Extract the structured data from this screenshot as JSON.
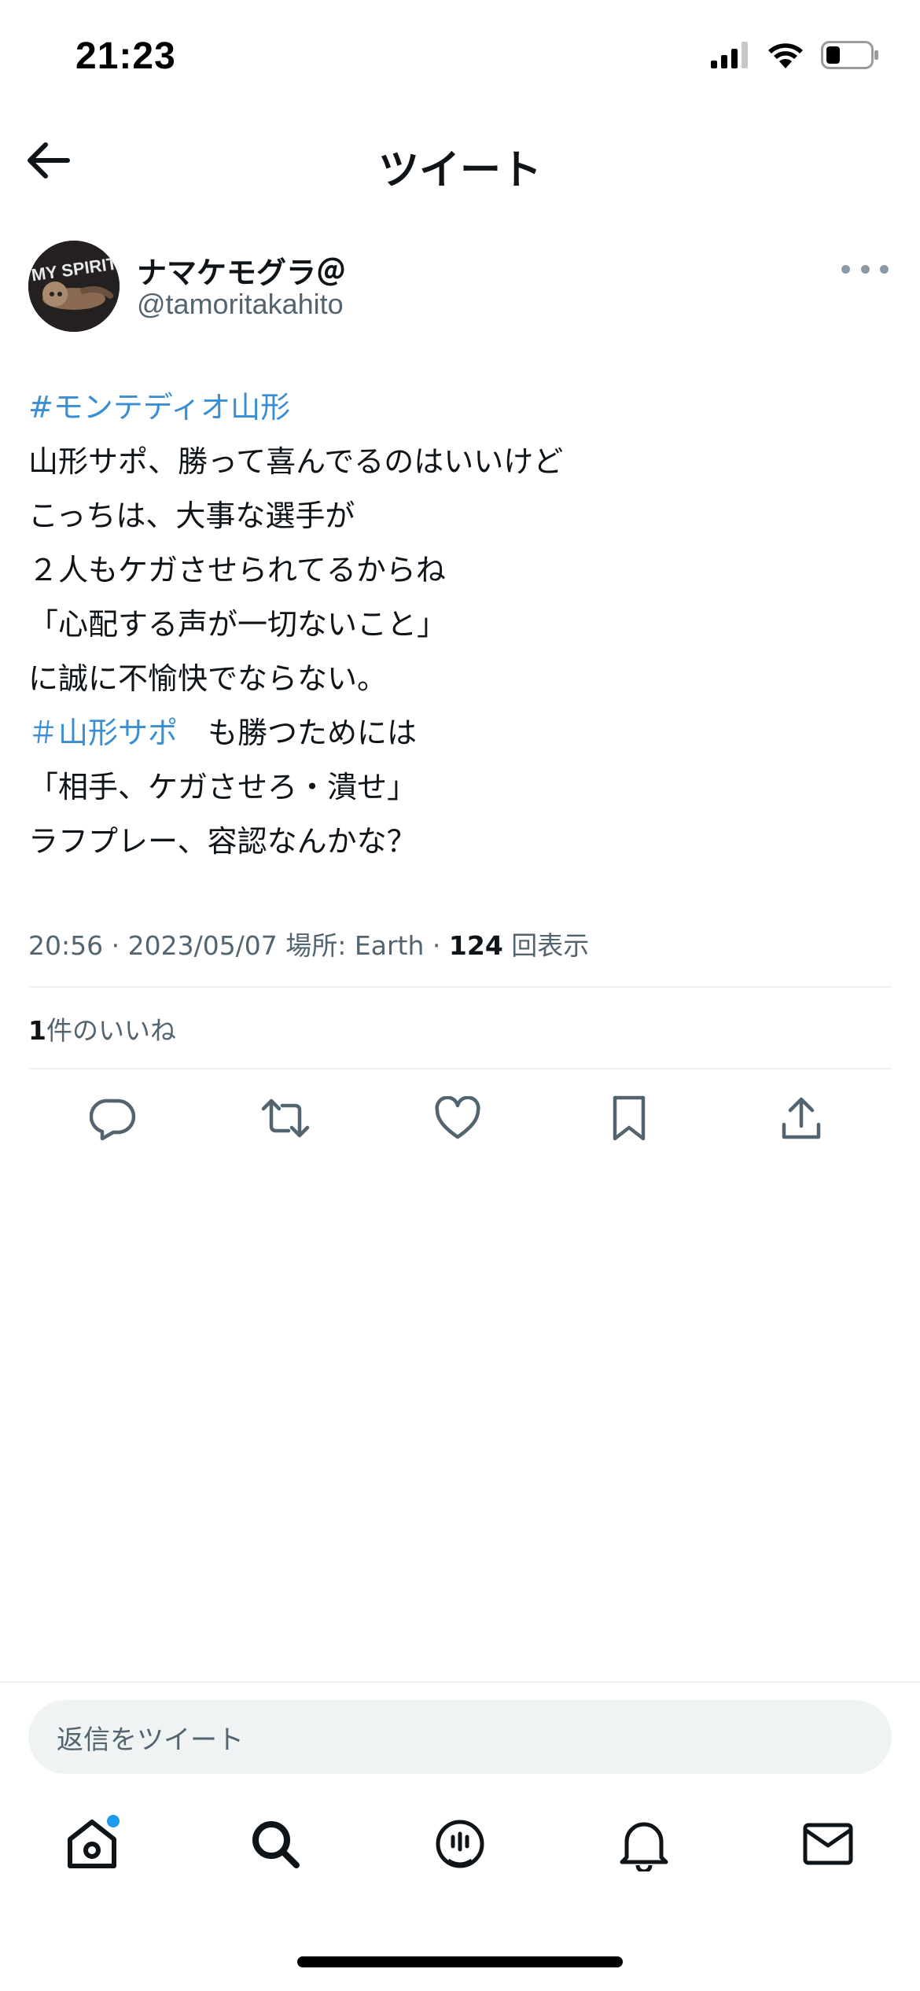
{
  "status_bar": {
    "time": "21:23",
    "icons": [
      "signal-icon",
      "wifi-icon",
      "battery-icon"
    ]
  },
  "header": {
    "title": "ツイート",
    "back_icon": "arrow-left-icon"
  },
  "tweet": {
    "author": {
      "display_name": "ナマケモグラ＠",
      "handle": "@tamoritakahito",
      "avatar_text": "MY SPIRIT"
    },
    "lines": [
      {
        "parts": [
          {
            "text": "#モンテディオ山形",
            "hashtag": true
          }
        ]
      },
      {
        "parts": [
          {
            "text": "山形サポ、勝って喜んでるのはいいけど",
            "hashtag": false
          }
        ]
      },
      {
        "parts": [
          {
            "text": "こっちは、大事な選手が",
            "hashtag": false
          }
        ]
      },
      {
        "parts": [
          {
            "text": "２人もケガさせられてるからね",
            "hashtag": false
          }
        ]
      },
      {
        "parts": [
          {
            "text": "「心配する声が一切ないこと」",
            "hashtag": false
          }
        ]
      },
      {
        "parts": [
          {
            "text": "に誠に不愉快でならない。",
            "hashtag": false
          }
        ]
      },
      {
        "parts": [
          {
            "text": "＃山形サポ",
            "hashtag": true
          },
          {
            "text": "　も勝つためには",
            "hashtag": false
          }
        ]
      },
      {
        "parts": [
          {
            "text": "「相手、ケガさせろ・潰せ」",
            "hashtag": false
          }
        ]
      },
      {
        "parts": [
          {
            "text": "ラフプレー、容認なんかな？",
            "hashtag": false
          }
        ]
      }
    ],
    "meta": {
      "time": "20:56",
      "date": "2023/05/07",
      "location_label": "場所: Earth",
      "views_count": "124",
      "views_label": "回表示"
    },
    "likes": {
      "count": "1",
      "label": "件のいいね"
    }
  },
  "actions": [
    {
      "name": "reply",
      "icon": "reply-icon"
    },
    {
      "name": "retweet",
      "icon": "retweet-icon"
    },
    {
      "name": "like",
      "icon": "heart-icon"
    },
    {
      "name": "bookmark",
      "icon": "bookmark-icon"
    },
    {
      "name": "share",
      "icon": "share-icon"
    }
  ],
  "reply_bar": {
    "placeholder": "返信をツイート"
  },
  "tabbar": [
    {
      "name": "home",
      "icon": "home-icon",
      "has_badge": true
    },
    {
      "name": "search",
      "icon": "search-icon",
      "has_badge": false
    },
    {
      "name": "spaces",
      "icon": "spaces-icon",
      "has_badge": false
    },
    {
      "name": "notifications",
      "icon": "bell-icon",
      "has_badge": false
    },
    {
      "name": "messages",
      "icon": "mail-icon",
      "has_badge": false
    }
  ],
  "colors": {
    "hashtag": "#3a8ed3",
    "text_primary": "#0f1419",
    "text_secondary": "#536471",
    "badge": "#1d9bf0"
  }
}
